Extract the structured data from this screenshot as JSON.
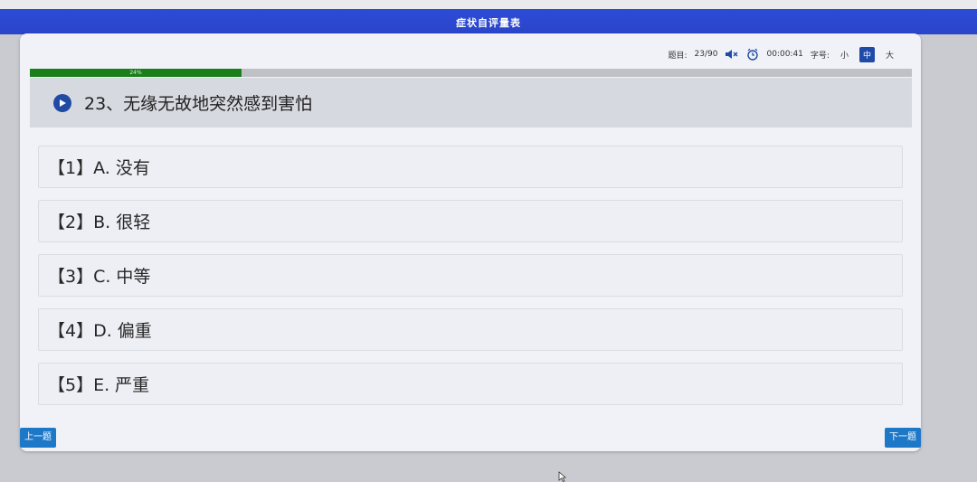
{
  "window": {
    "title": "症状自评量表"
  },
  "status": {
    "question_label": "题目:",
    "question_counter": "23/90",
    "timer": "00:00:41",
    "font_size_label": "字号:",
    "font_sizes": [
      "小",
      "中",
      "大"
    ],
    "active_font_size": "中"
  },
  "progress": {
    "value_percent": 24,
    "label": "24%"
  },
  "question": {
    "text": "23、无缘无故地突然感到害怕"
  },
  "options": [
    {
      "label": "【1】A. 没有"
    },
    {
      "label": "【2】B. 很轻"
    },
    {
      "label": "【3】C. 中等"
    },
    {
      "label": "【4】D. 偏重"
    },
    {
      "label": "【5】E. 严重"
    }
  ],
  "nav": {
    "prev_label": "上一题",
    "next_label": "下一题"
  },
  "colors": {
    "header_blue": "#2d4bd6",
    "progress_green": "#1a7f1a",
    "button_blue": "#1e78c8",
    "active_size_blue": "#1e4aa8"
  },
  "icons": [
    "mute-icon",
    "alarm-clock-icon",
    "play-icon"
  ]
}
